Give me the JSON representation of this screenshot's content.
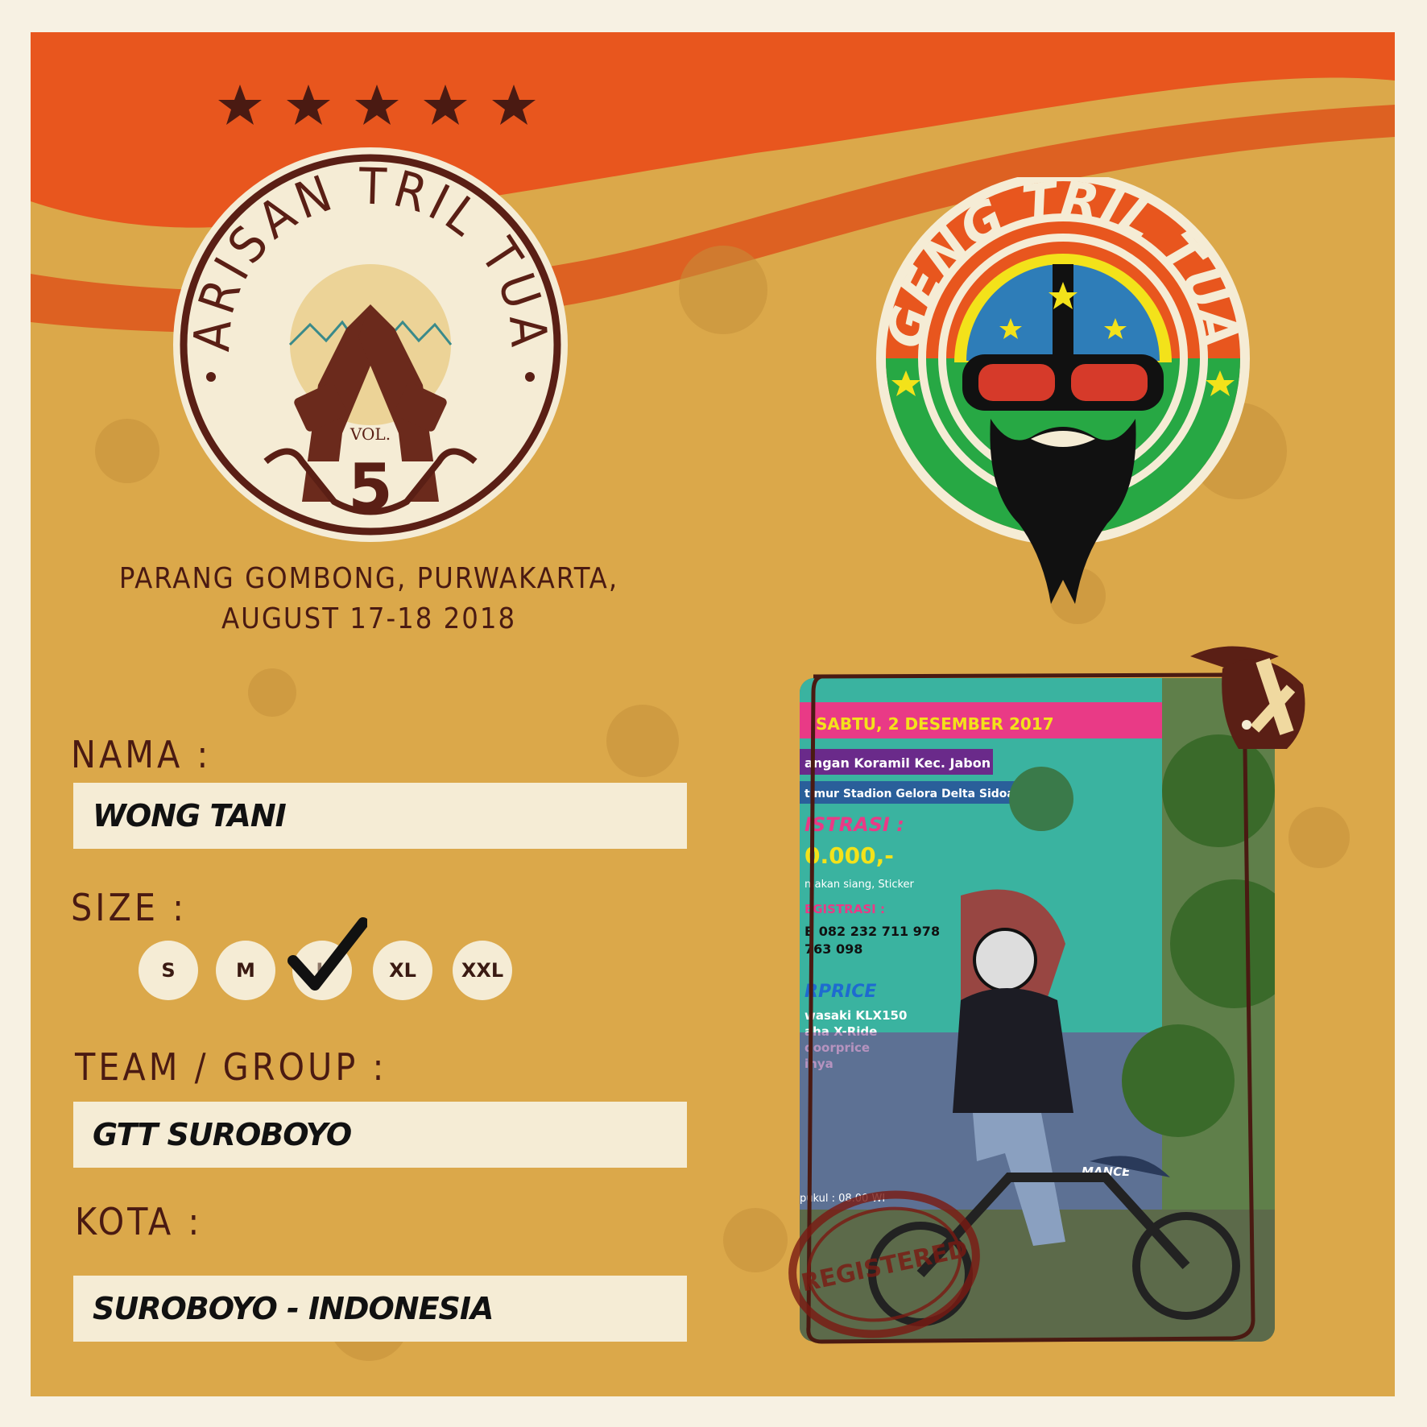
{
  "event": {
    "badge_title": "ARISAN TRIL TUA",
    "badge_vol": "VOL.",
    "badge_number": "5",
    "location_line1": "PARANG GOMBONG, PURWAKARTA,",
    "location_line2": "AUGUST 17-18 2018"
  },
  "club_logo": {
    "title": "GENG TRIL TUA"
  },
  "form": {
    "nama_label": "NAMA :",
    "nama_value": "WONG TANI",
    "size_label": "SIZE :",
    "sizes": [
      "S",
      "M",
      "L",
      "XL",
      "XXL"
    ],
    "size_selected": "L",
    "team_label": "TEAM / GROUP :",
    "team_value": "GTT SUROBOYO",
    "kota_label": "KOTA :",
    "kota_value": "SUROBOYO - INDONESIA"
  },
  "photo": {
    "banner_date": "SABTU, 2 DESEMBER 2017",
    "banner_venue1": "angan Koramil Kec. Jabon",
    "banner_venue2": "timur Stadion Gelora Delta Sidoarjo",
    "banner_reg": "ISTRASI :",
    "banner_price": "0.000,-",
    "banner_incl": "makan siang, Sticker",
    "banner_contact_title": "EGISTRASI :",
    "banner_phone1": "B 082 232 711 978",
    "banner_phone2": "763 098",
    "banner_prize_title": "RPRICE",
    "banner_prize1": "wasaki KLX150",
    "banner_prize2": "aha X-Ride",
    "banner_prize3": "doorprice",
    "banner_prize4": "inya",
    "banner_bottom": "MANCE",
    "banner_time": "pukul : 08.00 WI",
    "stamp": "REGISTERED"
  },
  "colors": {
    "background": "#dba84a",
    "stripe": "#e8561e",
    "ink": "#4a1a12",
    "field": "#f5ecd5"
  }
}
